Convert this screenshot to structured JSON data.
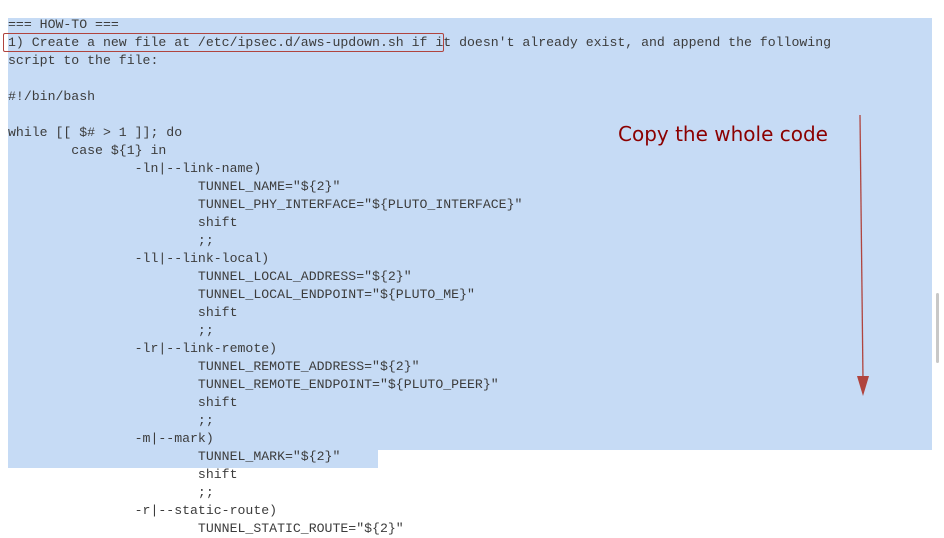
{
  "lines": [
    "=== HOW-TO ===",
    "1) Create a new file at /etc/ipsec.d/aws-updown.sh if it doesn't already exist, and append the following",
    "script to the file:",
    "",
    "#!/bin/bash",
    "",
    "while [[ $# > 1 ]]; do",
    "        case ${1} in",
    "                -ln|--link-name)",
    "                        TUNNEL_NAME=\"${2}\"",
    "                        TUNNEL_PHY_INTERFACE=\"${PLUTO_INTERFACE}\"",
    "                        shift",
    "                        ;;",
    "                -ll|--link-local)",
    "                        TUNNEL_LOCAL_ADDRESS=\"${2}\"",
    "                        TUNNEL_LOCAL_ENDPOINT=\"${PLUTO_ME}\"",
    "                        shift",
    "                        ;;",
    "                -lr|--link-remote)",
    "                        TUNNEL_REMOTE_ADDRESS=\"${2}\"",
    "                        TUNNEL_REMOTE_ENDPOINT=\"${PLUTO_PEER}\"",
    "                        shift",
    "                        ;;",
    "                -m|--mark)",
    "                        TUNNEL_MARK=\"${2}\"",
    "                        shift",
    "                        ;;",
    "                -r|--static-route)",
    "                        TUNNEL_STATIC_ROUTE=\"${2}\""
  ],
  "annotation": "Copy the whole code",
  "colors": {
    "selection": "#c6dbf5",
    "annotation": "#8b0000",
    "highlight_box": "#b0443e",
    "text": "#3c3c3c"
  },
  "icons": [
    "arrow-down-icon"
  ]
}
